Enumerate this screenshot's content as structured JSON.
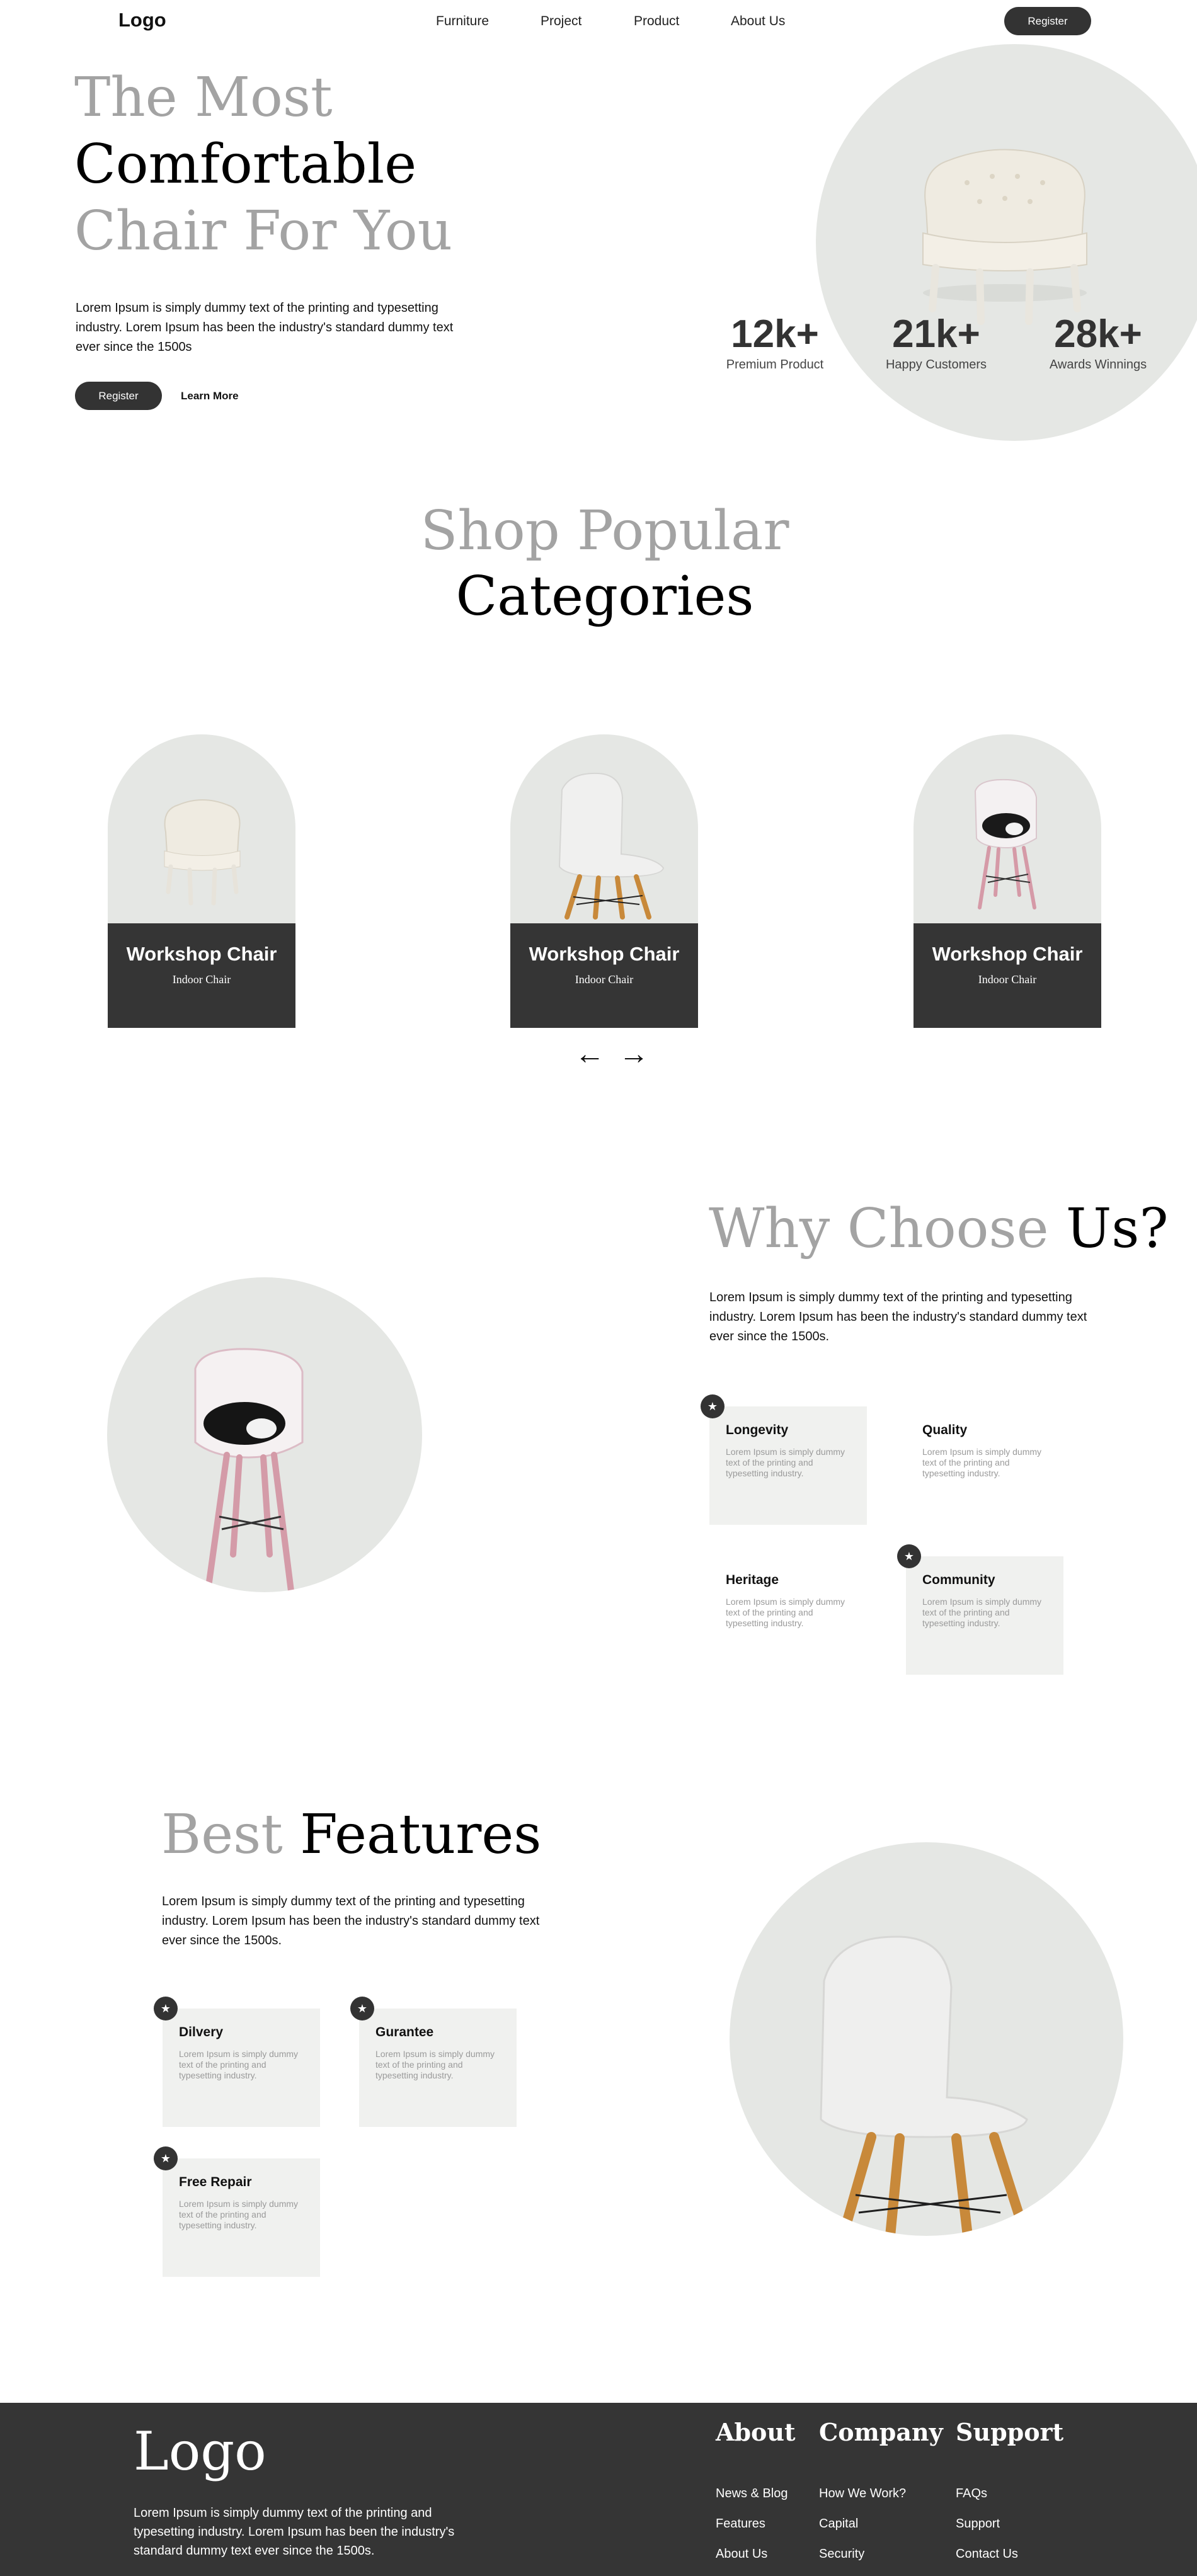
{
  "nav": {
    "logo": "Logo",
    "links": [
      "Furniture",
      "Project",
      "Product",
      "About Us"
    ],
    "register": "Register"
  },
  "hero": {
    "line1": "The Most",
    "line2": "Comfortable",
    "line3": "Chair For You",
    "desc": "Lorem Ipsum is simply dummy text of the printing and typesetting industry. Lorem Ipsum has been the industry's standard dummy text ever since the 1500s",
    "register": "Register",
    "learn_more": "Learn More",
    "stats": [
      {
        "value": "12k+",
        "label": "Premium Product"
      },
      {
        "value": "21k+",
        "label": "Happy Customers"
      },
      {
        "value": "28k+",
        "label": "Awards Winnings"
      }
    ]
  },
  "categories": {
    "title_grey": "Shop Popular",
    "title_dark": "Categories",
    "cards": [
      {
        "title": "Workshop Chair",
        "sub": "Indoor Chair"
      },
      {
        "title": "Workshop Chair",
        "sub": "Indoor Chair"
      },
      {
        "title": "Workshop Chair",
        "sub": "Indoor Chair"
      }
    ],
    "prev_arrow": "←",
    "next_arrow": "→"
  },
  "why": {
    "title_grey": "Why Choose",
    "title_dark": "Us?",
    "desc": "Lorem Ipsum is simply dummy text of the printing and typesetting industry. Lorem Ipsum has been the industry's standard dummy text ever since the 1500s.",
    "items": [
      {
        "title": "Longevity",
        "desc": "Lorem Ipsum is simply dummy text of the printing and typesetting industry."
      },
      {
        "title": "Quality",
        "desc": "Lorem Ipsum is simply dummy text of the printing and typesetting industry."
      },
      {
        "title": "Heritage",
        "desc": "Lorem Ipsum is simply dummy text of the printing and typesetting industry."
      },
      {
        "title": "Community",
        "desc": "Lorem Ipsum is simply dummy text of the printing and typesetting industry."
      }
    ]
  },
  "features": {
    "title_grey": "Best",
    "title_dark": "Features",
    "desc": "Lorem Ipsum is simply dummy text of the printing and typesetting industry. Lorem Ipsum has been the industry's standard dummy text ever since the 1500s.",
    "items": [
      {
        "title": "Dilvery",
        "desc": "Lorem Ipsum is simply dummy text of the printing and typesetting industry."
      },
      {
        "title": "Gurantee",
        "desc": "Lorem Ipsum is simply dummy text of the printing and typesetting industry."
      },
      {
        "title": "Free Repair",
        "desc": "Lorem Ipsum is simply dummy text of the printing and typesetting industry."
      }
    ]
  },
  "footer": {
    "logo": "Logo",
    "desc": "Lorem Ipsum is simply dummy text of the printing and typesetting industry. Lorem Ipsum has been the industry's standard dummy text ever since the 1500s.",
    "columns": [
      {
        "title": "About",
        "links": [
          "News & Blog",
          "Features",
          "About Us"
        ]
      },
      {
        "title": "Company",
        "links": [
          "How We Work?",
          "Capital",
          "Security"
        ]
      },
      {
        "title": "Support",
        "links": [
          "FAQs",
          "Support",
          "Contact Us"
        ]
      }
    ]
  },
  "icons": {
    "star": "star-icon"
  },
  "colors": {
    "dark": "#353535",
    "grey_text": "#a3a3a3",
    "circle_bg": "#e5e7e4",
    "card_bg": "#f0f1ef"
  }
}
